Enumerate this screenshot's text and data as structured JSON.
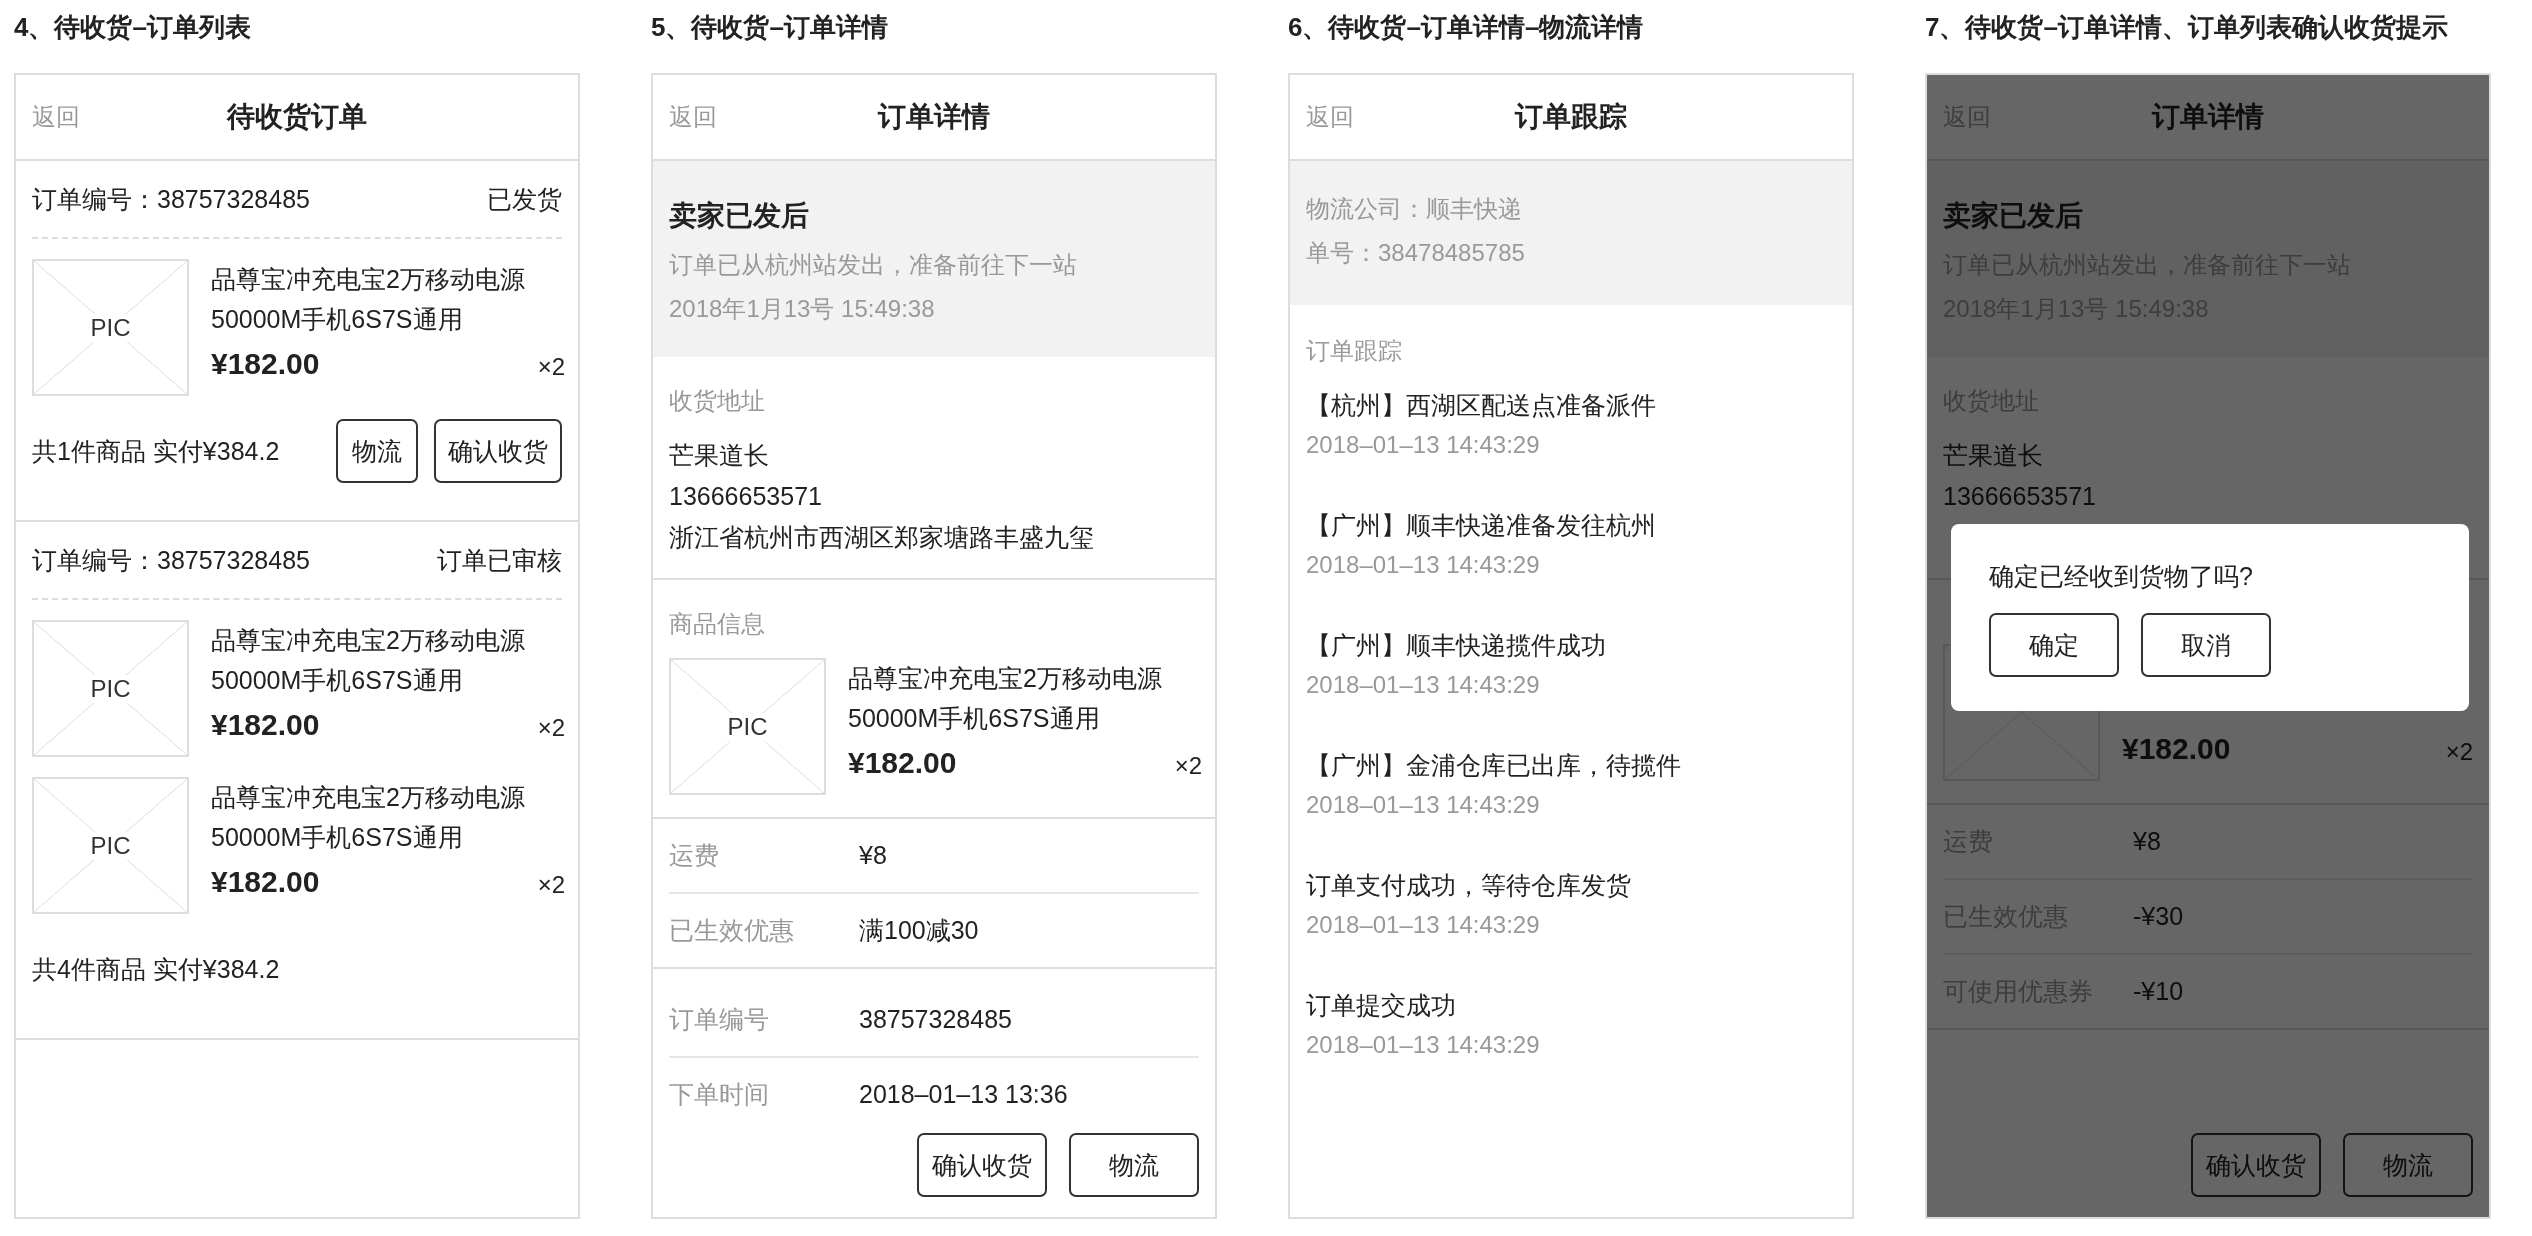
{
  "screens": [
    {
      "kind": "order_list",
      "caption": "4、待收货–订单列表",
      "nav": {
        "back": "返回",
        "title": "待收货订单"
      },
      "orders": [
        {
          "number": "订单编号：38757328485",
          "status": "已发货",
          "items": [
            {
              "pic": "PIC",
              "name": "品尊宝冲充电宝2万移动电源50000M手机6S7S通用",
              "price": "¥182.00",
              "qty": "×2"
            }
          ],
          "summary": "共1件商品 实付¥384.2",
          "buttons": [
            "物流",
            "确认收货"
          ]
        },
        {
          "number": "订单编号：38757328485",
          "status": "订单已审核",
          "items": [
            {
              "pic": "PIC",
              "name": "品尊宝冲充电宝2万移动电源50000M手机6S7S通用",
              "price": "¥182.00",
              "qty": "×2"
            },
            {
              "pic": "PIC",
              "name": "品尊宝冲充电宝2万移动电源50000M手机6S7S通用",
              "price": "¥182.00",
              "qty": "×2"
            }
          ],
          "summary": "共4件商品 实付¥384.2"
        }
      ]
    },
    {
      "kind": "order_detail",
      "caption": "5、待收货–订单详情",
      "nav": {
        "back": "返回",
        "title": "订单详情"
      },
      "dimmed": false,
      "status_block": {
        "title": "卖家已发后",
        "lines": [
          "订单已从杭州站发出，准备前往下一站",
          "2018年1月13号 15:49:38"
        ]
      },
      "address": {
        "label": "收货地址",
        "lines": [
          "芒果道长",
          "13666653571",
          "浙江省杭州市西湖区郑家塘路丰盛九玺"
        ]
      },
      "goods": {
        "label": "商品信息",
        "items": [
          {
            "pic": "PIC",
            "name": "品尊宝冲充电宝2万移动电源50000M手机6S7S通用",
            "price": "¥182.00",
            "qty": "×2"
          }
        ]
      },
      "fee_rows": [
        {
          "label": "运费",
          "value": "¥8"
        },
        {
          "label": "已生效优惠",
          "value": "满100减30"
        }
      ],
      "info_rows": [
        {
          "label": "订单编号",
          "value": "38757328485"
        },
        {
          "label": "下单时间",
          "value": "2018–01–13 13:36"
        }
      ],
      "buttons": [
        "确认收货",
        "物流"
      ]
    },
    {
      "kind": "tracking",
      "caption": "6、待收货–订单详情–物流详情",
      "nav": {
        "back": "返回",
        "title": "订单跟踪"
      },
      "carrier_lines": [
        "物流公司：顺丰快递",
        "单号：38478485785"
      ],
      "track_label": "订单跟踪",
      "events": [
        {
          "text": "【杭州】西湖区配送点准备派件",
          "time": "2018–01–13 14:43:29"
        },
        {
          "text": "【广州】顺丰快递准备发往杭州",
          "time": "2018–01–13 14:43:29"
        },
        {
          "text": "【广州】顺丰快递揽件成功",
          "time": "2018–01–13 14:43:29"
        },
        {
          "text": "【广州】金浦仓库已出库，待揽件",
          "time": "2018–01–13 14:43:29"
        },
        {
          "text": "订单支付成功，等待仓库发货",
          "time": "2018–01–13 14:43:29"
        },
        {
          "text": "订单提交成功",
          "time": "2018–01–13 14:43:29"
        }
      ]
    },
    {
      "kind": "order_detail",
      "caption": "7、待收货–订单详情、订单列表确认收货提示",
      "nav": {
        "back": "返回",
        "title": "订单详情"
      },
      "dimmed": true,
      "status_block": {
        "title": "卖家已发后",
        "lines": [
          "订单已从杭州站发出，准备前往下一站",
          "2018年1月13号 15:49:38"
        ]
      },
      "address": {
        "label": "收货地址",
        "lines": [
          "芒果道长",
          "13666653571"
        ]
      },
      "goods": {
        "items": [
          {
            "price": "¥182.00",
            "qty": "×2"
          }
        ]
      },
      "fee_rows": [
        {
          "label": "运费",
          "value": "¥8"
        },
        {
          "label": "已生效优惠",
          "value": "-¥30"
        },
        {
          "label": "可使用优惠券",
          "value": "-¥10"
        }
      ],
      "buttons": [
        "确认收货",
        "物流"
      ],
      "dialog": {
        "message": "确定已经收到货物了吗?",
        "buttons": [
          "确定",
          "取消"
        ]
      }
    }
  ]
}
